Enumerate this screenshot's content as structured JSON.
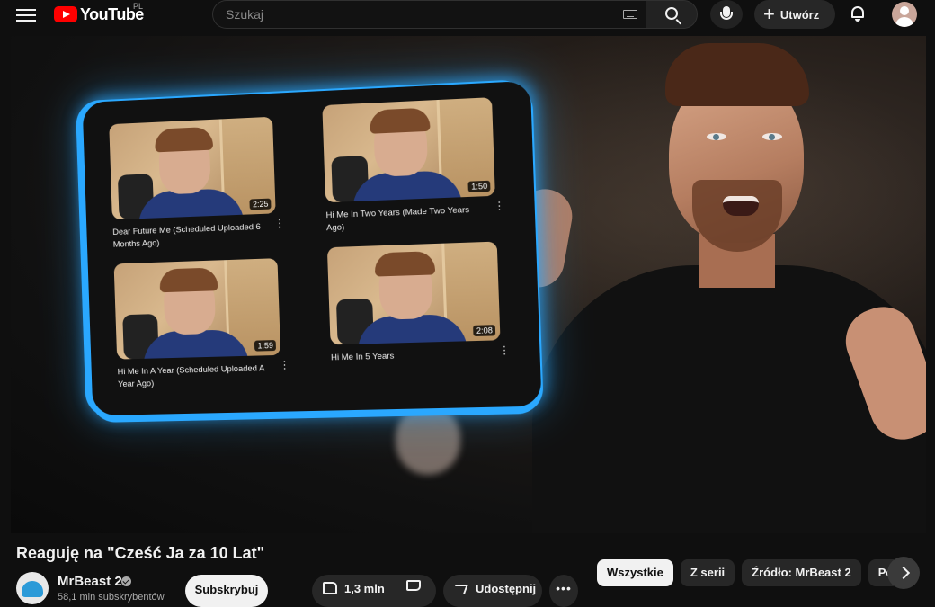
{
  "header": {
    "logo_text": "YouTube",
    "region": "PL",
    "search_placeholder": "Szukaj",
    "create_label": "Utwórz"
  },
  "video": {
    "embedded_videos": [
      {
        "title": "Dear Future Me (Scheduled Uploaded 6 Months Ago)",
        "duration": "2:25"
      },
      {
        "title": "Hi Me In Two Years (Made Two Years Ago)",
        "duration": "1:50"
      },
      {
        "title": "Hi Me In A Year (Scheduled Uploaded A Year Ago)",
        "duration": "1:59"
      },
      {
        "title": "Hi Me In 5 Years",
        "duration": "2:08"
      }
    ]
  },
  "info": {
    "title": "Reaguję na \"Cześć Ja za 10 Lat\"",
    "channel_name": "MrBeast 2",
    "subscribers": "58,1 mln subskrybentów",
    "subscribe_label": "Subskrybuj",
    "like_count": "1,3 mln",
    "share_label": "Udostępnij",
    "more_label": "•••"
  },
  "chips": [
    {
      "label": "Wszystkie",
      "active": true
    },
    {
      "label": "Z serii",
      "active": false
    },
    {
      "label": "Źródło: MrBeast 2",
      "active": false
    },
    {
      "label": "Podobne",
      "active": false
    }
  ],
  "colors": {
    "background": "#0f0f0f",
    "brand_red": "#ff0000",
    "glow_blue": "#2aa8ff",
    "chip_bg": "#272727"
  }
}
